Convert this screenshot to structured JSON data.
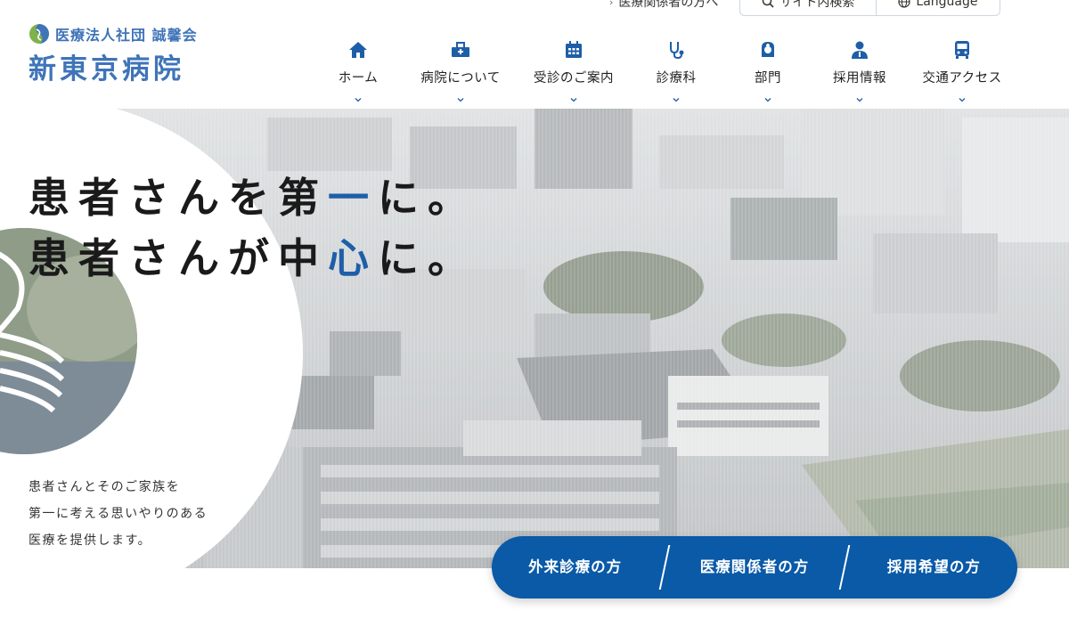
{
  "logo": {
    "corp": "医療法人社団 誠馨会",
    "name": "新東京病院"
  },
  "util": {
    "medical_link": "医療関係者の方へ",
    "search": "サイト内検索",
    "language": "Language"
  },
  "nav": {
    "items": [
      {
        "label": "ホーム",
        "icon": "home-icon"
      },
      {
        "label": "病院について",
        "icon": "hospital-icon"
      },
      {
        "label": "受診のご案内",
        "icon": "calendar-icon"
      },
      {
        "label": "診療科",
        "icon": "stethoscope-icon"
      },
      {
        "label": "部門",
        "icon": "nurse-icon"
      },
      {
        "label": "採用情報",
        "icon": "person-icon"
      },
      {
        "label": "交通アクセス",
        "icon": "bus-icon"
      }
    ]
  },
  "hero": {
    "line1_pre": "患者さんを第",
    "line1_accent": "一",
    "line1_post": "に。",
    "line2_pre": "患者さんが中",
    "line2_accent": "心",
    "line2_post": "に。",
    "sub1": "患者さんとそのご家族を",
    "sub2": "第一に考える思いやりのある",
    "sub3": "医療を提供します。"
  },
  "cta": {
    "outpatient": "外来診療の方",
    "medical": "医療関係者の方",
    "recruit": "採用希望の方"
  },
  "colors": {
    "brand": "#3f74b8",
    "nav_icon": "#1e5ea8",
    "cta_bg": "#0a5aa8"
  }
}
